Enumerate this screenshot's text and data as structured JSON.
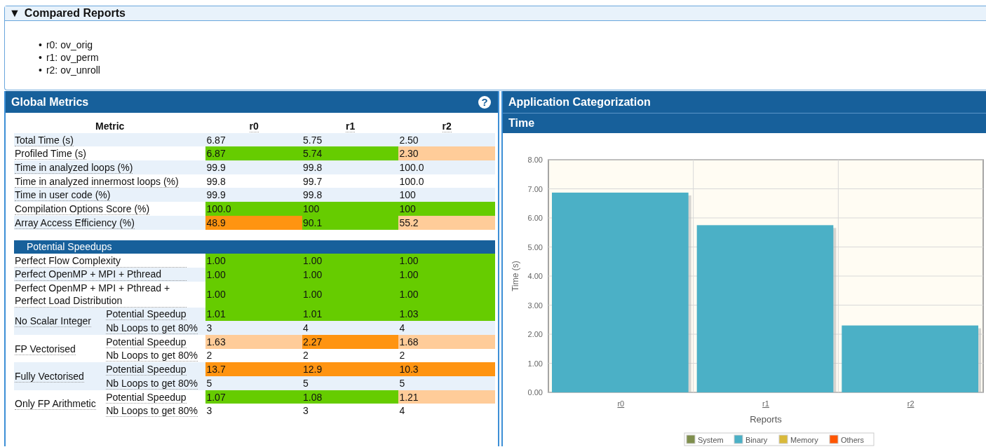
{
  "compared_reports": {
    "toggle": "▼",
    "title": "Compared Reports",
    "expanded": true,
    "items": [
      {
        "marker": "•",
        "text": "r0: ov_orig"
      },
      {
        "marker": "•",
        "text": "r1: ov_perm"
      },
      {
        "marker": "•",
        "text": "r2: ov_unroll"
      }
    ]
  },
  "global_metrics": {
    "title": "Global Metrics",
    "help_icon": "?",
    "metric_header": "Metric",
    "columns": [
      "r0",
      "r1",
      "r2"
    ],
    "rows": [
      {
        "label": "Total Time (s)",
        "cells": [
          {
            "text": "6.87"
          },
          {
            "text": "5.75"
          },
          {
            "text": "2.50"
          }
        ]
      },
      {
        "label": "Profiled Time (s)",
        "cells": [
          {
            "text": "6.87",
            "color": "#66cc00"
          },
          {
            "text": "5.74",
            "color": "#66cc00"
          },
          {
            "text": "2.30",
            "color": "#ffcc99"
          }
        ]
      },
      {
        "label": "Time in analyzed loops (%)",
        "cells": [
          {
            "text": "99.9"
          },
          {
            "text": "99.8"
          },
          {
            "text": "100.0"
          }
        ]
      },
      {
        "label": "Time in analyzed innermost loops (%)",
        "cells": [
          {
            "text": "99.8"
          },
          {
            "text": "99.7"
          },
          {
            "text": "100.0"
          }
        ]
      },
      {
        "label": "Time in user code (%)",
        "cells": [
          {
            "text": "99.9"
          },
          {
            "text": "99.8"
          },
          {
            "text": "100"
          }
        ]
      },
      {
        "label": "Compilation Options Score (%)",
        "cells": [
          {
            "text": "100.0",
            "color": "#66cc00"
          },
          {
            "text": "100",
            "color": "#66cc00"
          },
          {
            "text": "100",
            "color": "#66cc00"
          }
        ]
      },
      {
        "label": "Array Access Efficiency (%)",
        "cells": [
          {
            "text": "48.9",
            "color": "#ff9411"
          },
          {
            "text": "90.1",
            "color": "#66cc00"
          },
          {
            "text": "55.2",
            "color": "#ffcc99"
          }
        ]
      }
    ],
    "speedups": {
      "title": "Potential Speedups",
      "rows": [
        {
          "kind": "row",
          "label": "Perfect Flow Complexity",
          "cells": [
            {
              "text": "1.00",
              "color": "#66cc00"
            },
            {
              "text": "1.00",
              "color": "#66cc00"
            },
            {
              "text": "1.00",
              "color": "#66cc00"
            }
          ]
        },
        {
          "kind": "row",
          "label": "Perfect OpenMP + MPI + Pthread",
          "cells": [
            {
              "text": "1.00",
              "color": "#66cc00"
            },
            {
              "text": "1.00",
              "color": "#66cc00"
            },
            {
              "text": "1.00",
              "color": "#66cc00"
            }
          ]
        },
        {
          "kind": "row",
          "label": "Perfect OpenMP + MPI + Pthread + Perfect Load Distribution",
          "cells": [
            {
              "text": "1.00",
              "color": "#66cc00"
            },
            {
              "text": "1.00",
              "color": "#66cc00"
            },
            {
              "text": "1.00",
              "color": "#66cc00"
            }
          ]
        },
        {
          "kind": "group",
          "label": "No Scalar Integer",
          "rows": [
            {
              "label": "Potential Speedup",
              "cells": [
                {
                  "text": "1.01",
                  "color": "#66cc00"
                },
                {
                  "text": "1.01",
                  "color": "#66cc00"
                },
                {
                  "text": "1.03",
                  "color": "#66cc00"
                }
              ]
            },
            {
              "label": "Nb Loops to get 80%",
              "cells": [
                {
                  "text": "3"
                },
                {
                  "text": "4"
                },
                {
                  "text": "4"
                }
              ]
            }
          ]
        },
        {
          "kind": "group",
          "label": "FP Vectorised",
          "rows": [
            {
              "label": "Potential Speedup",
              "cells": [
                {
                  "text": "1.63",
                  "color": "#ffcc99"
                },
                {
                  "text": "2.27",
                  "color": "#ff9411"
                },
                {
                  "text": "1.68",
                  "color": "#ffcc99"
                }
              ]
            },
            {
              "label": "Nb Loops to get 80%",
              "cells": [
                {
                  "text": "2"
                },
                {
                  "text": "2"
                },
                {
                  "text": "2"
                }
              ]
            }
          ]
        },
        {
          "kind": "group",
          "label": "Fully Vectorised",
          "rows": [
            {
              "label": "Potential Speedup",
              "cells": [
                {
                  "text": "13.7",
                  "color": "#ff9411"
                },
                {
                  "text": "12.9",
                  "color": "#ff9411"
                },
                {
                  "text": "10.3",
                  "color": "#ff9411"
                }
              ]
            },
            {
              "label": "Nb Loops to get 80%",
              "cells": [
                {
                  "text": "5"
                },
                {
                  "text": "5"
                },
                {
                  "text": "5"
                }
              ]
            }
          ]
        },
        {
          "kind": "group",
          "label": "Only FP Arithmetic",
          "rows": [
            {
              "label": "Potential Speedup",
              "cells": [
                {
                  "text": "1.07",
                  "color": "#66cc00"
                },
                {
                  "text": "1.08",
                  "color": "#66cc00"
                },
                {
                  "text": "1.21",
                  "color": "#ffcc99"
                }
              ]
            },
            {
              "label": "Nb Loops to get 80%",
              "cells": [
                {
                  "text": "3"
                },
                {
                  "text": "3"
                },
                {
                  "text": "4"
                }
              ]
            }
          ]
        }
      ]
    }
  },
  "application_categorization": {
    "title": "Application Categorization",
    "subtitle": "Time",
    "chart_data": {
      "type": "bar",
      "xlabel": "Reports",
      "ylabel": "Time (s)",
      "categories": [
        "r0",
        "r1",
        "r2"
      ],
      "grid": true,
      "series": [
        {
          "name": "System",
          "color": "#7f8f4d",
          "values": [
            null,
            null,
            null
          ]
        },
        {
          "name": "Binary",
          "color": "#4bb0c6",
          "values": [
            6.87,
            5.75,
            2.3
          ]
        },
        {
          "name": "Memory",
          "color": "#d9b93a",
          "values": [
            null,
            null,
            null
          ]
        },
        {
          "name": "Others",
          "color": "#ff5500",
          "values": [
            null,
            null,
            null
          ]
        }
      ],
      "ylim": [
        0,
        8
      ],
      "yticks": [
        {
          "value": 0,
          "label": "0.00"
        },
        {
          "value": 1,
          "label": "1.00"
        },
        {
          "value": 2,
          "label": "2.00"
        },
        {
          "value": 3,
          "label": "3.00"
        },
        {
          "value": 4,
          "label": "4.00"
        },
        {
          "value": 5,
          "label": "5.00"
        },
        {
          "value": 6,
          "label": "6.00"
        },
        {
          "value": 7,
          "label": "7.00"
        },
        {
          "value": 8,
          "label": "8.00"
        }
      ]
    }
  }
}
